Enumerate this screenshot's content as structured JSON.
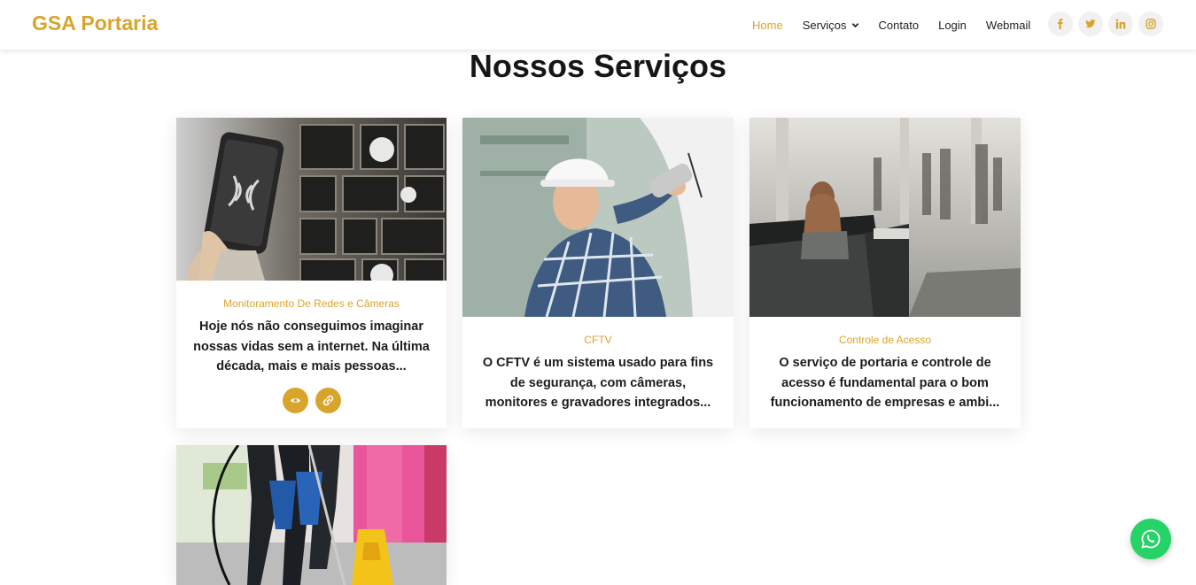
{
  "brand": {
    "name": "GSA Portaria",
    "accent": "#d9a42c"
  },
  "nav": {
    "items": [
      {
        "label": "Home",
        "active": true
      },
      {
        "label": "Serviços",
        "dropdown": true
      },
      {
        "label": "Contato"
      },
      {
        "label": "Login"
      },
      {
        "label": "Webmail"
      }
    ]
  },
  "social": [
    {
      "icon": "facebook-icon",
      "glyph": "f"
    },
    {
      "icon": "twitter-icon",
      "glyph": "t"
    },
    {
      "icon": "linkedin-icon",
      "glyph": "in"
    },
    {
      "icon": "instagram-icon",
      "glyph": "ig"
    }
  ],
  "section": {
    "title": "Nossos Serviços"
  },
  "cards": [
    {
      "category": "Monitoramento De Redes e Câmeras",
      "text": "Hoje nós não conseguimos imaginar nossas vidas sem a internet. Na última década, mais e mais pessoas...",
      "image": "smart-home-phone-photo",
      "actions": [
        "view-icon",
        "link-icon"
      ]
    },
    {
      "category": "CFTV",
      "text": "O CFTV é um sistema usado para fins de segurança, com câmeras, monitores e gravadores integrados...",
      "image": "technician-installing-camera-photo"
    },
    {
      "category": "Controle de Acesso",
      "text": "O serviço de portaria e controle de acesso é fundamental para o bom funcionamento de empresas e ambi...",
      "image": "reception-lobby-photo"
    },
    {
      "image": "cleaning-staff-photo"
    }
  ],
  "whatsapp": {
    "icon": "whatsapp-icon",
    "color": "#25d366"
  }
}
